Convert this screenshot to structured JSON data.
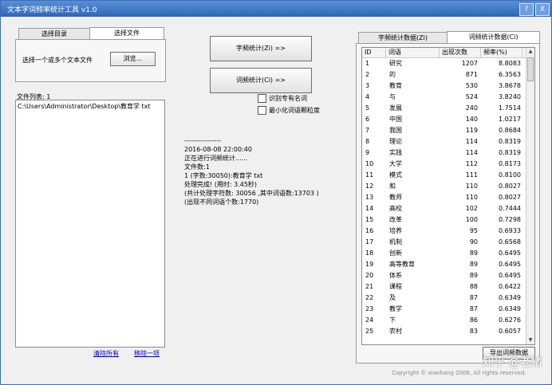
{
  "window": {
    "title": "文本字词频率统计工具 v1.0",
    "help_btn": "?",
    "close_btn": "X"
  },
  "left": {
    "tabs": [
      {
        "label": "选择目录"
      },
      {
        "label": "选择文件"
      }
    ],
    "select_label": "选择一个或多个文本文件",
    "browse_label": "浏览...",
    "file_list_label": "文件列表: 1",
    "file_path": "C:\\Users\\Administrator\\Desktop\\教育学 txt",
    "clear_all": "清除所有",
    "remove_one": "移除一项"
  },
  "middle": {
    "char_btn": "字频统计(Zi) =>",
    "word_btn": "词频统计(Ci) =>",
    "check_names": "识别专有名词",
    "check_min": "最小化词语颗粒度",
    "status_lines": [
      "----------------",
      "2016-08-08 22:00:40",
      "正在进行词频统计......",
      "文件数:1",
      "1 (字数:30050):教育学 txt",
      "处理完成! (用时: 3.45秒)",
      "    (共计处理字符数: 30056 ,其中词语数:13703 )",
      "    (出现不同词语个数:1770)"
    ]
  },
  "right": {
    "tabs": [
      {
        "label": "字频统计数据(Zi)"
      },
      {
        "label": "词频统计数据(Ci)"
      }
    ],
    "columns": [
      {
        "label": "ID"
      },
      {
        "label": "词语"
      },
      {
        "label": "出现次数"
      },
      {
        "label": "频率(%)"
      }
    ],
    "rows": [
      {
        "id": "1",
        "word": "研究",
        "count": "1207",
        "freq": "8.8083"
      },
      {
        "id": "2",
        "word": "的",
        "count": "871",
        "freq": "6.3563"
      },
      {
        "id": "3",
        "word": "教育",
        "count": "530",
        "freq": "3.8678"
      },
      {
        "id": "4",
        "word": "与",
        "count": "524",
        "freq": "3.8240"
      },
      {
        "id": "5",
        "word": "发展",
        "count": "240",
        "freq": "1.7514"
      },
      {
        "id": "6",
        "word": "中国",
        "count": "140",
        "freq": "1.0217"
      },
      {
        "id": "7",
        "word": "我国",
        "count": "119",
        "freq": "0.8684"
      },
      {
        "id": "8",
        "word": "理论",
        "count": "114",
        "freq": "0.8319"
      },
      {
        "id": "9",
        "word": "实践",
        "count": "114",
        "freq": "0.8319"
      },
      {
        "id": "10",
        "word": "大学",
        "count": "112",
        "freq": "0.8173"
      },
      {
        "id": "11",
        "word": "模式",
        "count": "111",
        "freq": "0.8100"
      },
      {
        "id": "12",
        "word": "和",
        "count": "110",
        "freq": "0.8027"
      },
      {
        "id": "13",
        "word": "教师",
        "count": "110",
        "freq": "0.8027"
      },
      {
        "id": "14",
        "word": "高校",
        "count": "102",
        "freq": "0.7444"
      },
      {
        "id": "15",
        "word": "改革",
        "count": "100",
        "freq": "0.7298"
      },
      {
        "id": "16",
        "word": "培养",
        "count": "95",
        "freq": "0.6933"
      },
      {
        "id": "17",
        "word": "机制",
        "count": "90",
        "freq": "0.6568"
      },
      {
        "id": "18",
        "word": "创新",
        "count": "89",
        "freq": "0.6495"
      },
      {
        "id": "19",
        "word": "高等教育",
        "count": "89",
        "freq": "0.6495"
      },
      {
        "id": "20",
        "word": "体系",
        "count": "89",
        "freq": "0.6495"
      },
      {
        "id": "21",
        "word": "课程",
        "count": "88",
        "freq": "0.6422"
      },
      {
        "id": "22",
        "word": "及",
        "count": "87",
        "freq": "0.6349"
      },
      {
        "id": "23",
        "word": "教学",
        "count": "87",
        "freq": "0.6349"
      },
      {
        "id": "24",
        "word": "下",
        "count": "86",
        "freq": "0.6276"
      },
      {
        "id": "25",
        "word": "农村",
        "count": "83",
        "freq": "0.6057"
      }
    ],
    "export_label": "导出词频数据"
  },
  "footer": {
    "copyright": "Copyright © xiaohang 2006, All rights reserved.",
    "watermark": "知乎 @老猪"
  }
}
